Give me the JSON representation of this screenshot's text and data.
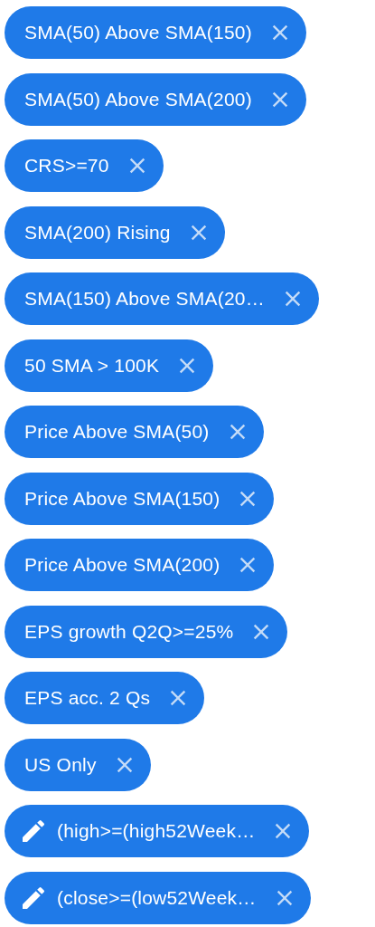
{
  "chips": [
    {
      "kind": "filter",
      "label": "SMA(50) Above SMA(150)"
    },
    {
      "kind": "filter",
      "label": "SMA(50) Above SMA(200)"
    },
    {
      "kind": "filter",
      "label": "CRS>=70"
    },
    {
      "kind": "filter",
      "label": "SMA(200) Rising"
    },
    {
      "kind": "filter",
      "label": "SMA(150) Above SMA(20…"
    },
    {
      "kind": "filter",
      "label": "50 SMA > 100K"
    },
    {
      "kind": "filter",
      "label": "Price Above SMA(50)"
    },
    {
      "kind": "filter",
      "label": "Price Above SMA(150)"
    },
    {
      "kind": "filter",
      "label": "Price Above SMA(200)"
    },
    {
      "kind": "filter",
      "label": "EPS growth Q2Q>=25%"
    },
    {
      "kind": "filter",
      "label": "EPS acc. 2 Qs"
    },
    {
      "kind": "filter",
      "label": "US Only"
    },
    {
      "kind": "custom",
      "label": "(high>=(high52Week…"
    },
    {
      "kind": "custom",
      "label": "(close>=(low52Week…"
    }
  ]
}
